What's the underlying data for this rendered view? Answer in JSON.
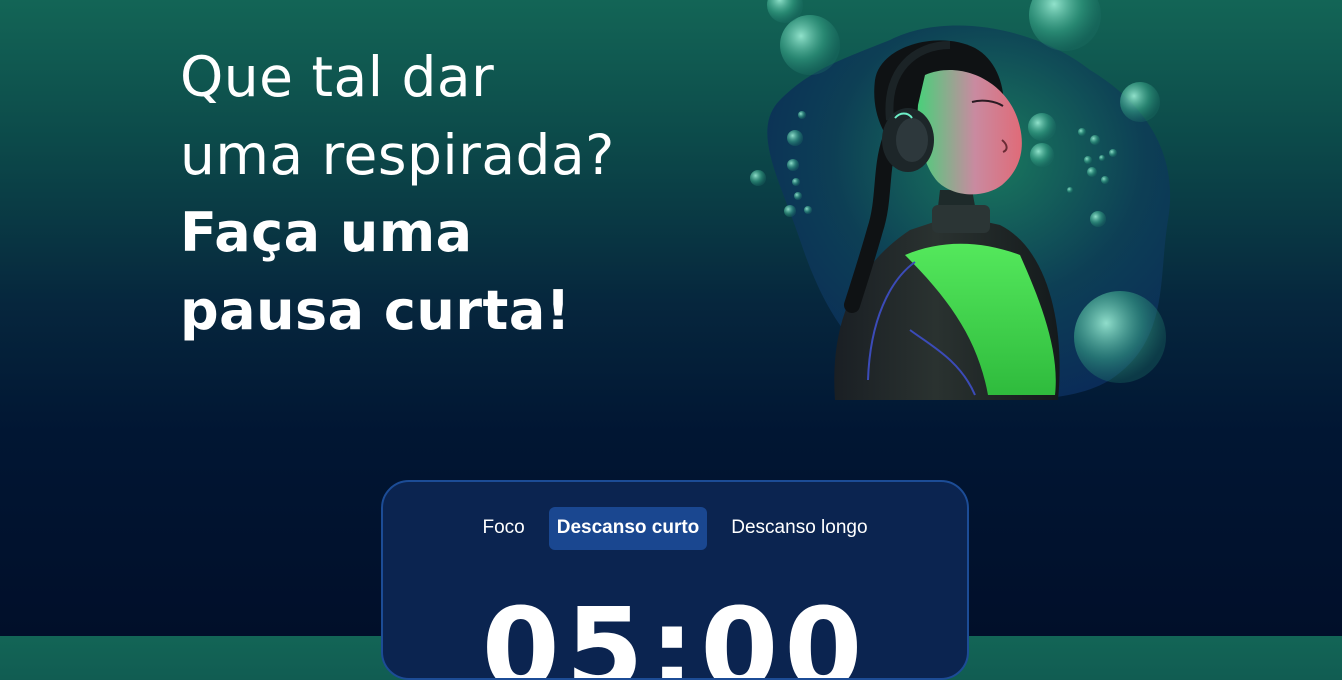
{
  "hero": {
    "line1": "Que tal dar",
    "line2": "uma respirada?",
    "line3": "Faça uma",
    "line4": "pausa curta!"
  },
  "timer": {
    "tabs": [
      {
        "label": "Foco",
        "active": false
      },
      {
        "label": "Descanso curto",
        "active": true
      },
      {
        "label": "Descanso longo",
        "active": false
      }
    ],
    "display": "05:00"
  },
  "colors": {
    "background_top": "#136556",
    "background_bottom": "#010f2a",
    "card_background": "#0b2450",
    "card_border": "#1c4c96",
    "active_tab": "#1a4790"
  }
}
